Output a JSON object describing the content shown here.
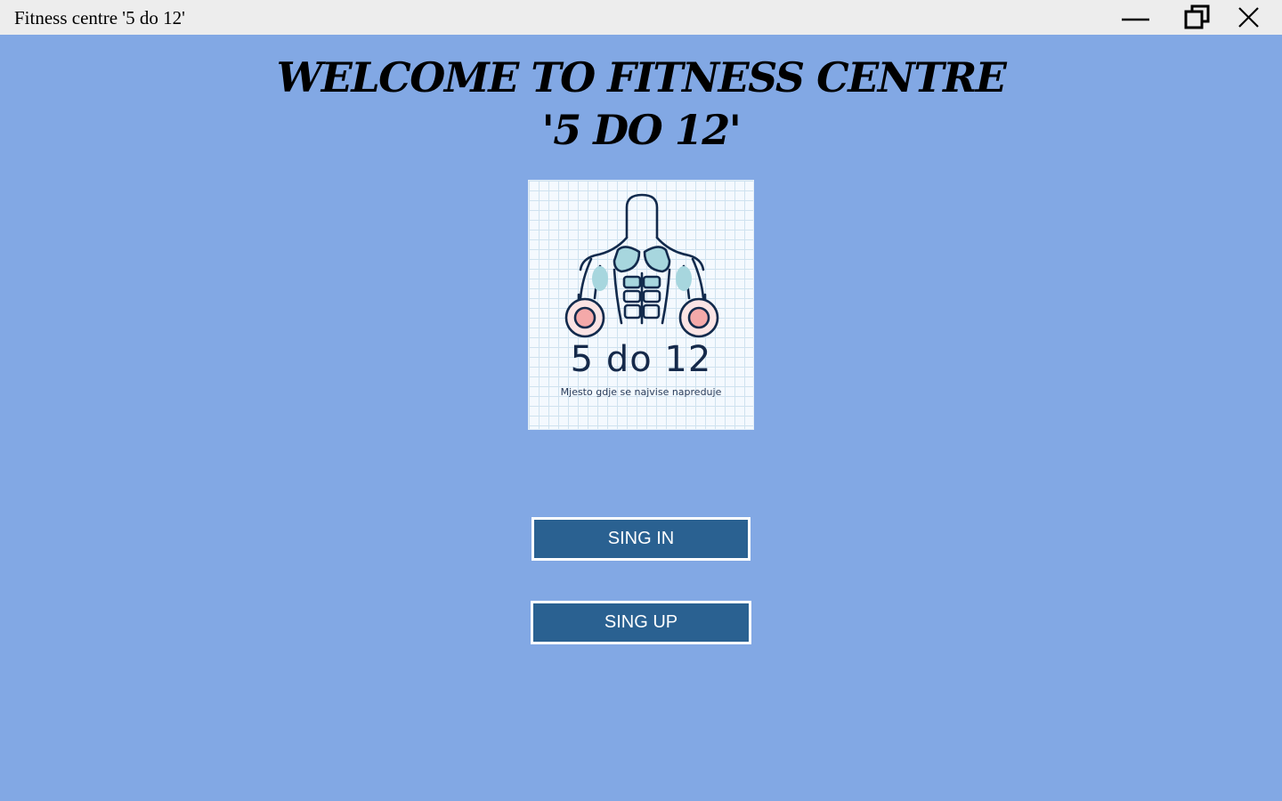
{
  "window": {
    "title": "Fitness centre '5 do 12'",
    "controls": [
      "minimize-icon",
      "restore-icon",
      "close-icon"
    ]
  },
  "main": {
    "heading_line1": "WELCOME TO FITNESS CENTRE",
    "heading_line2": "'5 DO 12'",
    "logo": {
      "name": "5 do 12",
      "tagline": "Mjesto gdje se najvise napreduje",
      "icon": "bodybuilder-dumbbells-icon"
    },
    "signin_label": "SING IN",
    "signup_label": "SING UP"
  },
  "colors": {
    "background": "#82a8e4",
    "button_fill": "#2a6191",
    "button_border": "#ffffff",
    "titlebar": "#ededed"
  }
}
